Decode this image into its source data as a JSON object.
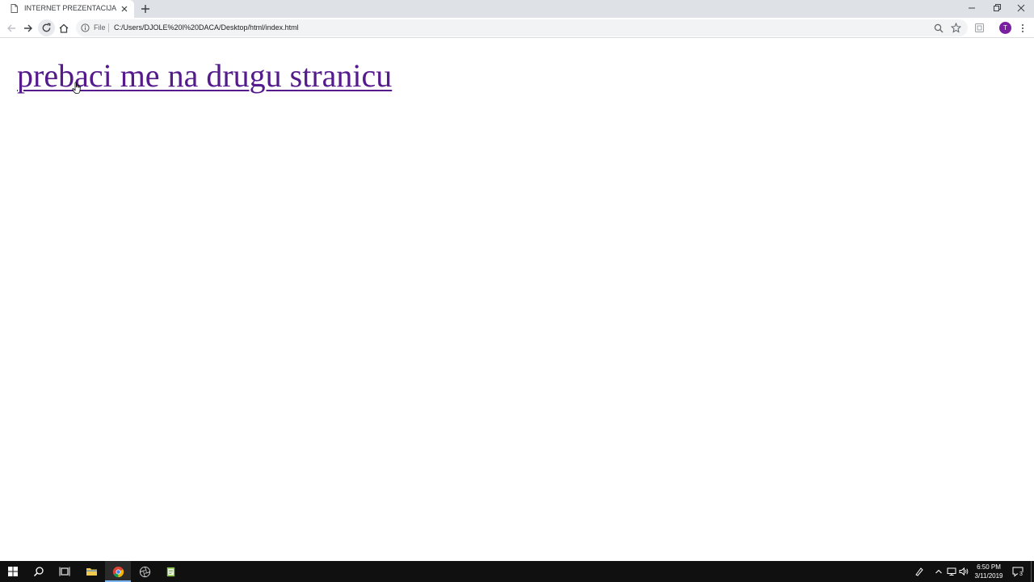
{
  "browser": {
    "tab": {
      "title": "INTERNET PREZENTACIJA"
    },
    "omnibox": {
      "scheme_label": "File",
      "url": "C:/Users/DJOLE%20I%20DACA/Desktop/html/index.html"
    },
    "profile_initial": "T",
    "accent_colors": {
      "profile": "#7b1fa2",
      "visited_link": "#551a8b"
    }
  },
  "page": {
    "link_text": "prebaci me na drugu stranicu"
  },
  "taskbar": {
    "time": "6:50 PM",
    "date": "3/11/2019",
    "notification_count": "3"
  }
}
